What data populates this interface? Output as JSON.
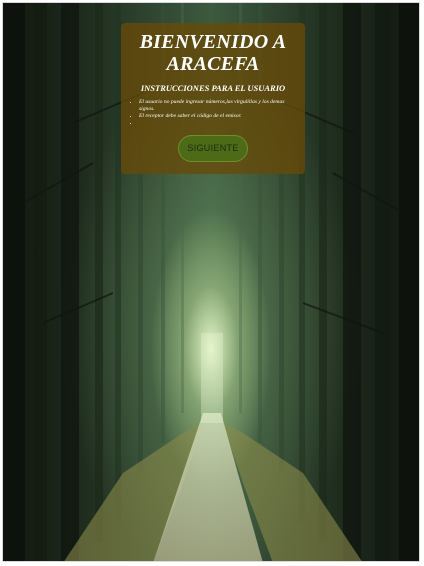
{
  "welcome": {
    "title": "BIENVENIDO A ARACEFA",
    "subtitle": "INSTRUCCIONES PARA EL USUARIO",
    "rules": [
      "El usuario no puede ingresar números,las virgulillas y los demas signos.",
      "El receptor debe saber el código de el emisor.",
      ""
    ],
    "next_button": "SIGUIENTE"
  },
  "colors": {
    "panel": "#684a08",
    "button": "#4d6a17",
    "text": "#ffffff"
  }
}
